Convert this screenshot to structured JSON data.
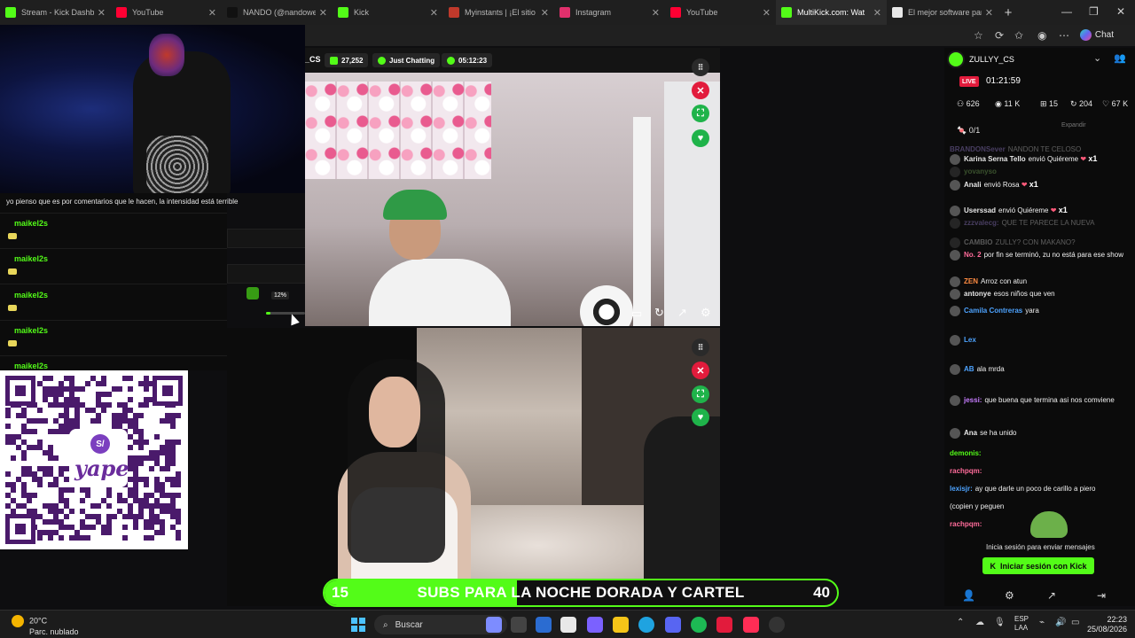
{
  "tabs": [
    {
      "title": "Stream - Kick Dashboard",
      "color": "#53fc18"
    },
    {
      "title": "YouTube",
      "color": "#ff0033"
    },
    {
      "title": "NANDO (@nandoweedl)",
      "color": "#111111"
    },
    {
      "title": "Kick",
      "color": "#53fc18"
    },
    {
      "title": "Myinstants | ¡El sitio web",
      "color": "#c0392b"
    },
    {
      "title": "Instagram",
      "color": "#e1306c"
    },
    {
      "title": "YouTube",
      "color": "#ff0033"
    },
    {
      "title": "MultiKick.com: Wat",
      "color": "#53fc18"
    },
    {
      "title": "El mejor software para p",
      "color": "#e8e8e8"
    }
  ],
  "active_tab_index": 7,
  "toolbar": {
    "chat_label": "Chat"
  },
  "left_chat": {
    "header_msg": "yo pienso que es por comentarios que le hacen, la intensidad está terrible",
    "users": [
      "maikel2s",
      "maikel2s",
      "maikel2s",
      "maikel2s",
      "maikel2s"
    ]
  },
  "qr": {
    "brand": "yape"
  },
  "stream1": {
    "channel": "_CS",
    "viewers": "27,252",
    "category": "Just Chatting",
    "uptime": "05:12:23",
    "volume": "12%"
  },
  "banner": {
    "left": "15",
    "text": "SUBS PARA LA NOCHE DORADA Y CARTEL",
    "right": "40",
    "progress": 0.375
  },
  "right_panel": {
    "channel": "ZULLYY_CS",
    "live": "LIVE",
    "timer": "01:21:59",
    "stats": [
      {
        "icon": "users-icon",
        "value": "626"
      },
      {
        "icon": "eye-icon",
        "value": "11 K"
      },
      {
        "icon": "gift-icon",
        "value": "15"
      },
      {
        "icon": "subs-icon",
        "value": "204"
      },
      {
        "icon": "heart-icon",
        "value": "67 K"
      }
    ],
    "goal": "0/1",
    "expand": "Expandir",
    "sign_in_text": "Inicia sesión para enviar mensajes",
    "sign_in_button": "Iniciar sesión con Kick"
  },
  "chat": [
    {
      "user": "BRANDONSever",
      "msg": "NANDON TE CELOSO",
      "color": "#b99bff",
      "faded": true
    },
    {
      "user": "Karina Serna Tello",
      "msg": "envió Quiéreme",
      "color": "#e6e6e6",
      "gift": "x1"
    },
    {
      "user": "yovanyso",
      "msg": "",
      "color": "#8fd16b",
      "faded": true
    },
    {
      "user": "Anali",
      "msg": "envió Rosa",
      "color": "#e6e6e6",
      "gift": "x1"
    },
    {
      "user": "Userssad",
      "msg": "envió Quiéreme",
      "color": "#e6e6e6",
      "gift": "x1"
    },
    {
      "user": "zzzvalecg:",
      "msg": "QUE TE PARECE LA NUEVA",
      "color": "#b99bff",
      "faded": true
    },
    {
      "user": "CAMBIO",
      "msg": "ZULLY? CON MAKANO?",
      "color": "#e6e6e6",
      "faded": true
    },
    {
      "user": "No. 2",
      "msg": "por fin se terminó, zu no está para ese show",
      "color": "#ff6b9a"
    },
    {
      "user": "ZEN",
      "msg": "Arroz con atun",
      "color": "#ff8c42"
    },
    {
      "user": "antonye",
      "msg": "esos niños que ven",
      "color": "#e6e6e6"
    },
    {
      "user": "Camila Contreras",
      "msg": "yara",
      "color": "#4da3ff"
    },
    {
      "user": "Lex",
      "msg": "",
      "color": "#4da3ff"
    },
    {
      "user": "AB",
      "msg": "ala mrda",
      "color": "#4da3ff"
    },
    {
      "user": "jessi:",
      "msg": "que buena que termina asi nos comviene",
      "color": "#c77dff"
    },
    {
      "user": "Ana",
      "msg": "se ha unido",
      "color": "#e6e6e6"
    },
    {
      "user": "demonis:",
      "msg": "",
      "color": "#53fc18"
    },
    {
      "user": "rachpqm:",
      "msg": "",
      "color": "#ff6b9a"
    },
    {
      "user": "lexisjr:",
      "msg": "ay que darle un poco de carillo a piero",
      "color": "#4da3ff"
    },
    {
      "user": "",
      "msg": "(copien y peguen",
      "color": "#e6e6e6"
    },
    {
      "user": "rachpqm:",
      "msg": "",
      "color": "#ff6b9a"
    }
  ],
  "taskbar": {
    "temp": "20°C",
    "weather": "Parc. nublado",
    "search": "Buscar",
    "lang1": "ESP",
    "lang2": "LAA",
    "time": "22:23",
    "date": "25/08/2026"
  }
}
